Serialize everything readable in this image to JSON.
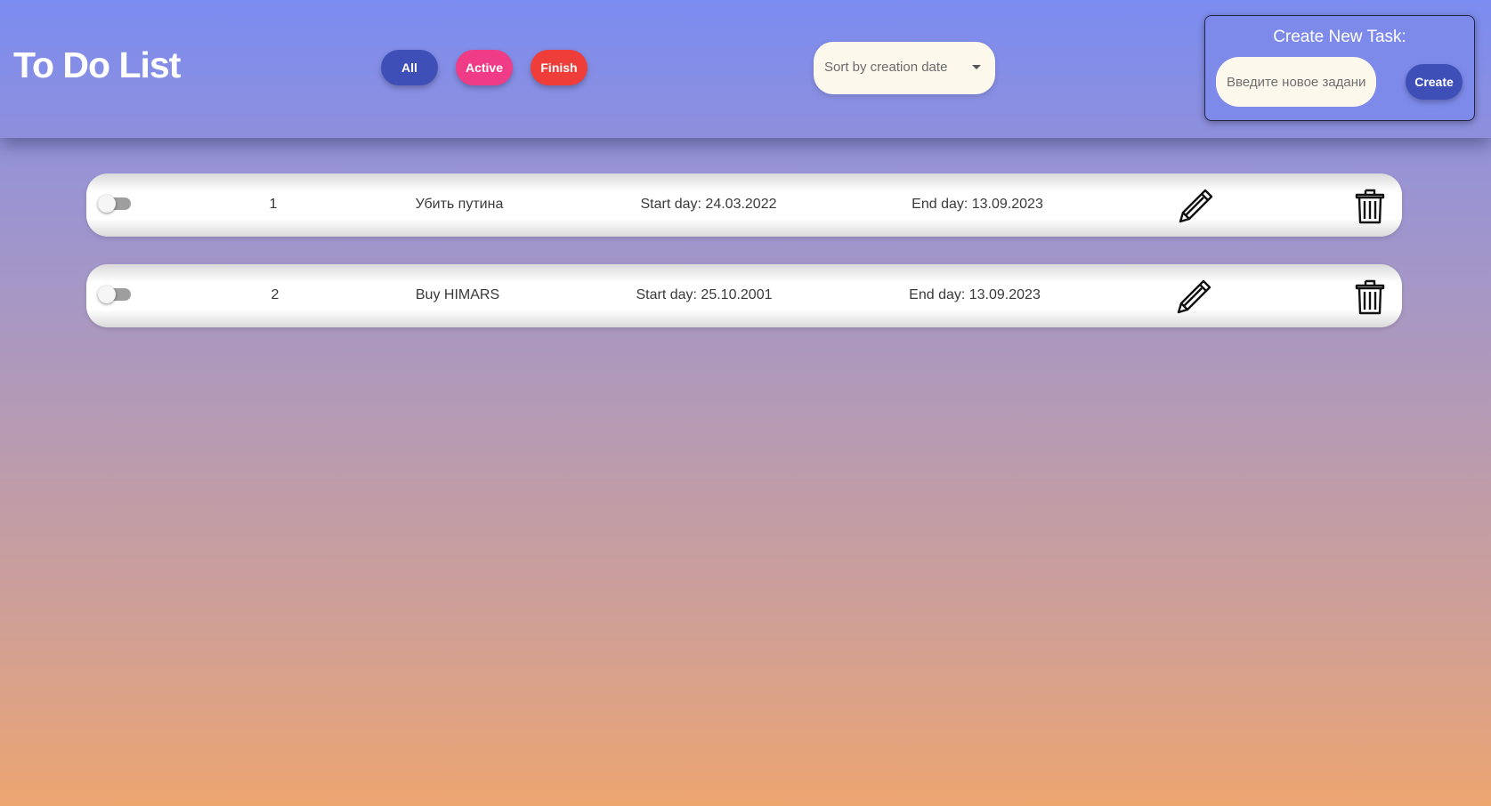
{
  "header": {
    "title": "To Do List",
    "filters": {
      "all": "All",
      "active": "Active",
      "finish": "Finish"
    },
    "sort": {
      "selected": "Sort by creation date"
    }
  },
  "create_panel": {
    "title": "Create New Task:",
    "input_placeholder": "Введите новое задани...",
    "button_label": "Create"
  },
  "tasks": [
    {
      "number": "1",
      "name": "Убить путина",
      "start": "Start day: 24.03.2022",
      "end": "End day: 13.09.2023",
      "completed": false
    },
    {
      "number": "2",
      "name": "Buy HIMARS",
      "start": "Start day: 25.10.2001",
      "end": "End day: 13.09.2023",
      "completed": false
    }
  ],
  "colors": {
    "btn_all": "#3f4fb8",
    "btn_active": "#f03b86",
    "btn_finish": "#ef3d3a",
    "header_bg": "#7b8cf0",
    "input_bg": "#fdf8ec"
  },
  "icons": {
    "edit": "pencil-icon",
    "delete": "trash-icon",
    "sort": "chevron-down-icon"
  }
}
